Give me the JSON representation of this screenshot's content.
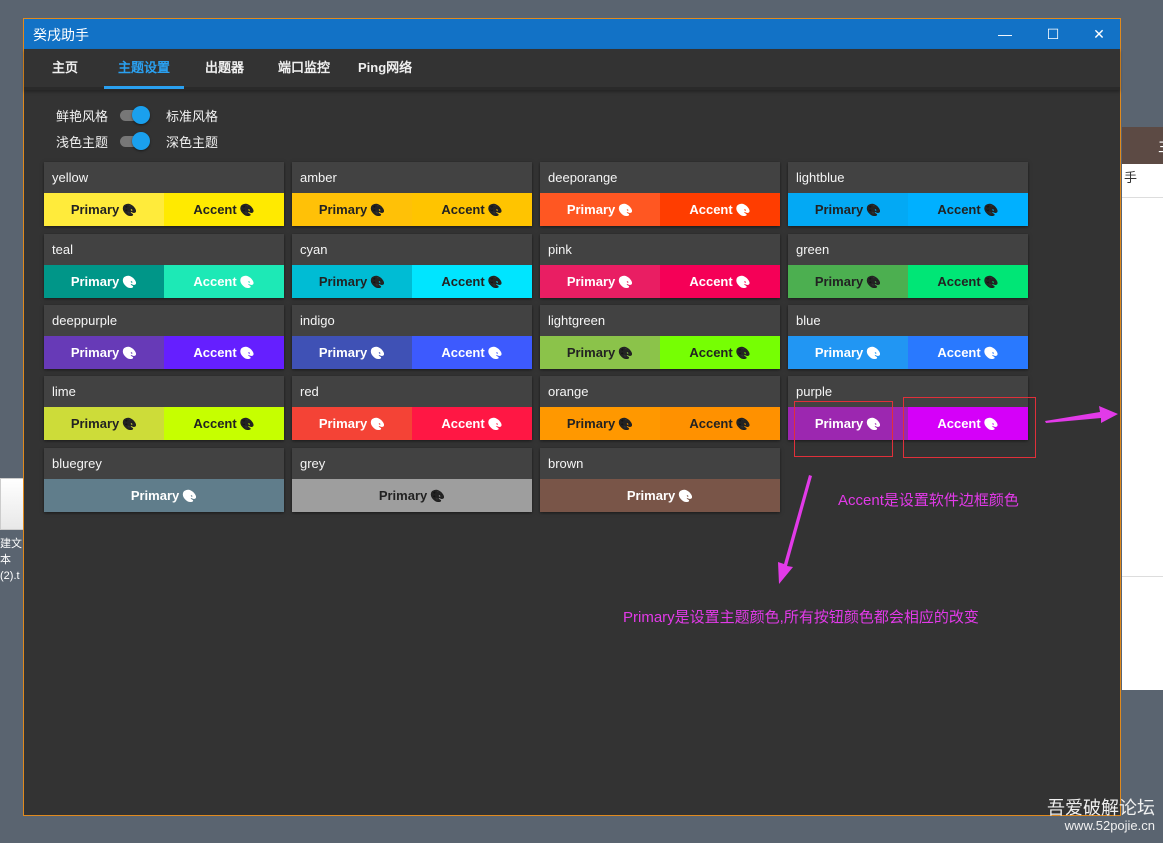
{
  "window": {
    "title": "癸戌助手",
    "controls": {
      "minimize": "—",
      "maximize": "☐",
      "close": "✕"
    }
  },
  "tabs": [
    {
      "label": "主页",
      "active": false
    },
    {
      "label": "主题设置",
      "active": true
    },
    {
      "label": "出题器",
      "active": false
    },
    {
      "label": "端口监控",
      "active": false
    },
    {
      "label": "Ping网络",
      "active": false
    }
  ],
  "options": {
    "row1": {
      "left": "鲜艳风格",
      "right": "标准风格"
    },
    "row2": {
      "left": "浅色主题",
      "right": "深色主题"
    }
  },
  "swatches": [
    {
      "name": "yellow",
      "primary": {
        "label": "Primary",
        "bg": "#ffeb3b",
        "fg": "#222"
      },
      "accent": {
        "label": "Accent",
        "bg": "#ffea00",
        "fg": "#222"
      }
    },
    {
      "name": "amber",
      "primary": {
        "label": "Primary",
        "bg": "#ffc107",
        "fg": "#222"
      },
      "accent": {
        "label": "Accent",
        "bg": "#ffc400",
        "fg": "#222"
      }
    },
    {
      "name": "deeporange",
      "primary": {
        "label": "Primary",
        "bg": "#ff5722",
        "fg": "#fff"
      },
      "accent": {
        "label": "Accent",
        "bg": "#ff3d00",
        "fg": "#fff"
      }
    },
    {
      "name": "lightblue",
      "primary": {
        "label": "Primary",
        "bg": "#03a9f4",
        "fg": "#222"
      },
      "accent": {
        "label": "Accent",
        "bg": "#00b0ff",
        "fg": "#222"
      }
    },
    {
      "name": "teal",
      "primary": {
        "label": "Primary",
        "bg": "#009688",
        "fg": "#fff"
      },
      "accent": {
        "label": "Accent",
        "bg": "#1de9b6",
        "fg": "#fff"
      }
    },
    {
      "name": "cyan",
      "primary": {
        "label": "Primary",
        "bg": "#00bcd4",
        "fg": "#222"
      },
      "accent": {
        "label": "Accent",
        "bg": "#00e5ff",
        "fg": "#222"
      }
    },
    {
      "name": "pink",
      "primary": {
        "label": "Primary",
        "bg": "#e91e63",
        "fg": "#fff"
      },
      "accent": {
        "label": "Accent",
        "bg": "#f50057",
        "fg": "#fff"
      }
    },
    {
      "name": "green",
      "primary": {
        "label": "Primary",
        "bg": "#4caf50",
        "fg": "#222"
      },
      "accent": {
        "label": "Accent",
        "bg": "#00e676",
        "fg": "#222"
      }
    },
    {
      "name": "deeppurple",
      "primary": {
        "label": "Primary",
        "bg": "#673ab7",
        "fg": "#fff"
      },
      "accent": {
        "label": "Accent",
        "bg": "#651fff",
        "fg": "#fff"
      }
    },
    {
      "name": "indigo",
      "primary": {
        "label": "Primary",
        "bg": "#3f51b5",
        "fg": "#fff"
      },
      "accent": {
        "label": "Accent",
        "bg": "#3d5afe",
        "fg": "#fff"
      }
    },
    {
      "name": "lightgreen",
      "primary": {
        "label": "Primary",
        "bg": "#8bc34a",
        "fg": "#222"
      },
      "accent": {
        "label": "Accent",
        "bg": "#76ff03",
        "fg": "#222"
      }
    },
    {
      "name": "blue",
      "primary": {
        "label": "Primary",
        "bg": "#2196f3",
        "fg": "#fff"
      },
      "accent": {
        "label": "Accent",
        "bg": "#2979ff",
        "fg": "#fff"
      }
    },
    {
      "name": "lime",
      "primary": {
        "label": "Primary",
        "bg": "#cddc39",
        "fg": "#222"
      },
      "accent": {
        "label": "Accent",
        "bg": "#c6ff00",
        "fg": "#222"
      }
    },
    {
      "name": "red",
      "primary": {
        "label": "Primary",
        "bg": "#f44336",
        "fg": "#fff"
      },
      "accent": {
        "label": "Accent",
        "bg": "#ff1744",
        "fg": "#fff"
      }
    },
    {
      "name": "orange",
      "primary": {
        "label": "Primary",
        "bg": "#ff9800",
        "fg": "#222"
      },
      "accent": {
        "label": "Accent",
        "bg": "#ff9100",
        "fg": "#222"
      }
    },
    {
      "name": "purple",
      "primary": {
        "label": "Primary",
        "bg": "#9c27b0",
        "fg": "#fff"
      },
      "accent": {
        "label": "Accent",
        "bg": "#d500f9",
        "fg": "#fff"
      }
    },
    {
      "name": "bluegrey",
      "primary": {
        "label": "Primary",
        "bg": "#607d8b",
        "fg": "#fff"
      },
      "accent": null
    },
    {
      "name": "grey",
      "primary": {
        "label": "Primary",
        "bg": "#9e9e9e",
        "fg": "#222"
      },
      "accent": null
    },
    {
      "name": "brown",
      "primary": {
        "label": "Primary",
        "bg": "#795548",
        "fg": "#fff"
      },
      "accent": null
    }
  ],
  "annotations": {
    "accent_note": "Accent是设置软件边框颜色",
    "primary_note": "Primary是设置主题颜色,所有按钮颜色都会相应的改变",
    "color": "#e23ae8"
  },
  "background": {
    "right_window_title_fragment": "主",
    "right_window_sub_fragment": "手",
    "desktop_label_1": "建文本",
    "desktop_label_2": "(2).t"
  },
  "watermark": {
    "line1": "吾爱破解论坛",
    "line2": "www.52pojie.cn"
  },
  "icons": {
    "palette": "palette-icon"
  }
}
